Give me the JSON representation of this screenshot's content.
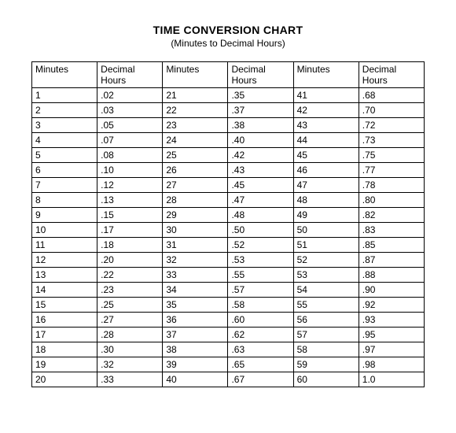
{
  "title": "TIME CONVERSION CHART",
  "subtitle": "(Minutes to Decimal Hours)",
  "headers": [
    "Minutes",
    "Decimal Hours",
    "Minutes",
    "Decimal Hours",
    "Minutes",
    "Decimal Hours"
  ],
  "rows": [
    [
      "1",
      ".02",
      "21",
      ".35",
      "41",
      ".68"
    ],
    [
      "2",
      ".03",
      "22",
      ".37",
      "42",
      ".70"
    ],
    [
      "3",
      ".05",
      "23",
      ".38",
      "43",
      ".72"
    ],
    [
      "4",
      ".07",
      "24",
      ".40",
      "44",
      ".73"
    ],
    [
      "5",
      ".08",
      "25",
      ".42",
      "45",
      ".75"
    ],
    [
      "6",
      ".10",
      "26",
      ".43",
      "46",
      ".77"
    ],
    [
      "7",
      ".12",
      "27",
      ".45",
      "47",
      ".78"
    ],
    [
      "8",
      ".13",
      "28",
      ".47",
      "48",
      ".80"
    ],
    [
      "9",
      ".15",
      "29",
      ".48",
      "49",
      ".82"
    ],
    [
      "10",
      ".17",
      "30",
      ".50",
      "50",
      ".83"
    ],
    [
      "11",
      ".18",
      "31",
      ".52",
      "51",
      ".85"
    ],
    [
      "12",
      ".20",
      "32",
      ".53",
      "52",
      ".87"
    ],
    [
      "13",
      ".22",
      "33",
      ".55",
      "53",
      ".88"
    ],
    [
      "14",
      ".23",
      "34",
      ".57",
      "54",
      ".90"
    ],
    [
      "15",
      ".25",
      "35",
      ".58",
      "55",
      ".92"
    ],
    [
      "16",
      ".27",
      "36",
      ".60",
      "56",
      ".93"
    ],
    [
      "17",
      ".28",
      "37",
      ".62",
      "57",
      ".95"
    ],
    [
      "18",
      ".30",
      "38",
      ".63",
      "58",
      ".97"
    ],
    [
      "19",
      ".32",
      "39",
      ".65",
      "59",
      ".98"
    ],
    [
      "20",
      ".33",
      "40",
      ".67",
      "60",
      "1.0"
    ]
  ],
  "chart_data": {
    "type": "table",
    "title": "Time Conversion Chart (Minutes to Decimal Hours)",
    "columns": [
      "Minutes",
      "Decimal Hours"
    ],
    "data": [
      [
        1,
        0.02
      ],
      [
        2,
        0.03
      ],
      [
        3,
        0.05
      ],
      [
        4,
        0.07
      ],
      [
        5,
        0.08
      ],
      [
        6,
        0.1
      ],
      [
        7,
        0.12
      ],
      [
        8,
        0.13
      ],
      [
        9,
        0.15
      ],
      [
        10,
        0.17
      ],
      [
        11,
        0.18
      ],
      [
        12,
        0.2
      ],
      [
        13,
        0.22
      ],
      [
        14,
        0.23
      ],
      [
        15,
        0.25
      ],
      [
        16,
        0.27
      ],
      [
        17,
        0.28
      ],
      [
        18,
        0.3
      ],
      [
        19,
        0.32
      ],
      [
        20,
        0.33
      ],
      [
        21,
        0.35
      ],
      [
        22,
        0.37
      ],
      [
        23,
        0.38
      ],
      [
        24,
        0.4
      ],
      [
        25,
        0.42
      ],
      [
        26,
        0.43
      ],
      [
        27,
        0.45
      ],
      [
        28,
        0.47
      ],
      [
        29,
        0.48
      ],
      [
        30,
        0.5
      ],
      [
        31,
        0.52
      ],
      [
        32,
        0.53
      ],
      [
        33,
        0.55
      ],
      [
        34,
        0.57
      ],
      [
        35,
        0.58
      ],
      [
        36,
        0.6
      ],
      [
        37,
        0.62
      ],
      [
        38,
        0.63
      ],
      [
        39,
        0.65
      ],
      [
        40,
        0.67
      ],
      [
        41,
        0.68
      ],
      [
        42,
        0.7
      ],
      [
        43,
        0.72
      ],
      [
        44,
        0.73
      ],
      [
        45,
        0.75
      ],
      [
        46,
        0.77
      ],
      [
        47,
        0.78
      ],
      [
        48,
        0.8
      ],
      [
        49,
        0.82
      ],
      [
        50,
        0.83
      ],
      [
        51,
        0.85
      ],
      [
        52,
        0.87
      ],
      [
        53,
        0.88
      ],
      [
        54,
        0.9
      ],
      [
        55,
        0.92
      ],
      [
        56,
        0.93
      ],
      [
        57,
        0.95
      ],
      [
        58,
        0.97
      ],
      [
        59,
        0.98
      ],
      [
        60,
        1.0
      ]
    ]
  }
}
